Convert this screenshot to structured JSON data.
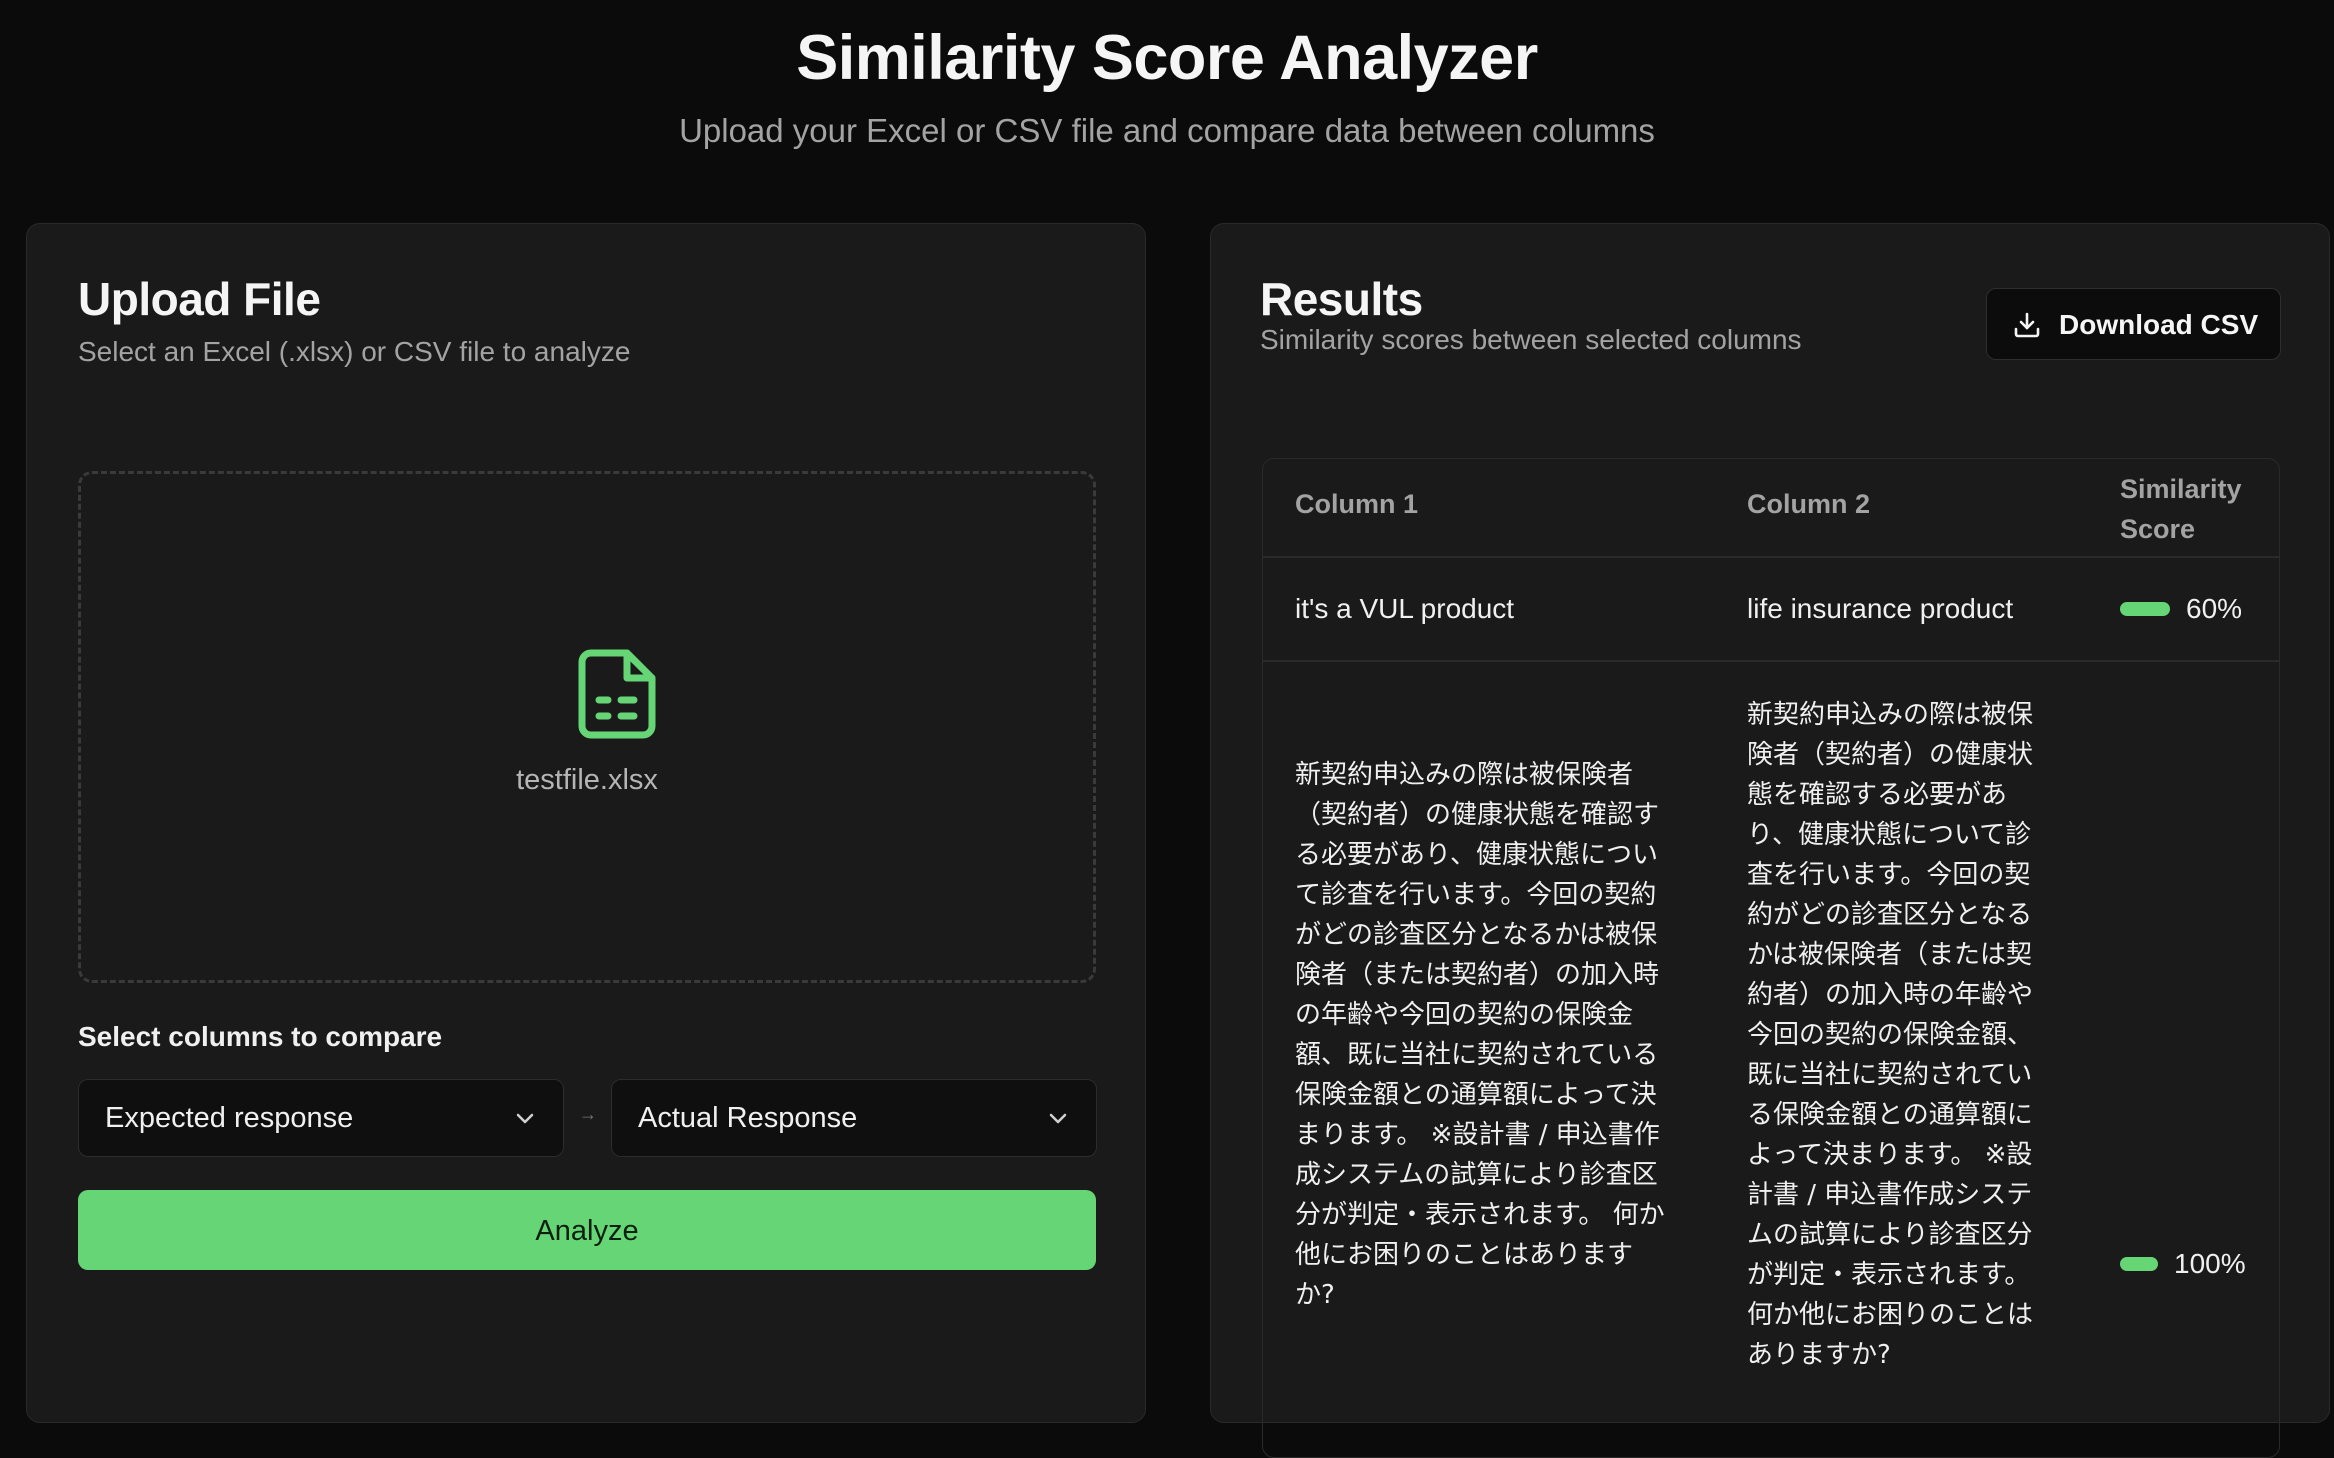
{
  "header": {
    "title": "Similarity Score Analyzer",
    "subtitle": "Upload your Excel or CSV file and compare data between columns"
  },
  "upload": {
    "title": "Upload File",
    "description": "Select an Excel (.xlsx) or CSV file to analyze",
    "file_name": "testfile.xlsx",
    "file_icon": "file-spreadsheet-icon",
    "columns_label": "Select columns to compare",
    "column1_selected": "Expected response",
    "column2_selected": "Actual Response",
    "arrow": "→",
    "analyze_label": "Analyze"
  },
  "results": {
    "title": "Results",
    "description": "Similarity scores between selected columns",
    "download_label": "Download CSV",
    "download_icon": "download-icon",
    "table": {
      "headers": [
        "Column 1",
        "Column 2",
        "Similarity Score"
      ],
      "header_score_line1": "Similarity",
      "header_score_line2": "Score",
      "rows": [
        {
          "col1": "it's a VUL product",
          "col2": "life insurance product",
          "score": 0.6,
          "score_label": "60%"
        },
        {
          "col1_lines": [
            "新契約申込みの際は被保険者",
            "（契約者）の健康状態を確認す",
            "る必要があり、健康状態につい",
            "て診査を行います。今回の契約",
            "がどの診査区分となるかは被保",
            "険者（または契約者）の加入時",
            "の年齢や今回の契約の保険金",
            "額、既に当社に契約されている",
            "保険金額との通算額によって決",
            "まります。 ※設計書 / 申込書作",
            "成システムの試算により診査区",
            "分が判定・表示されます。 何か",
            "他にお困りのことはあります",
            "か?"
          ],
          "col2_lines": [
            "新契約申込みの際は被保",
            "険者（契約者）の健康状",
            "態を確認する必要があ",
            "り、健康状態について診",
            "査を行います。今回の契",
            "約がどの診査区分となる",
            "かは被保険者（または契",
            "約者）の加入時の年齢や",
            "今回の契約の保険金額、",
            "既に当社に契約されてい",
            "る保険金額との通算額に",
            "よって決まります。 ※設",
            "計書 / 申込書作成システ",
            "ムの試算により診査区分",
            "が判定・表示されます。",
            "何か他にお困りのことは",
            "ありますか?"
          ],
          "score": 1.0,
          "score_label": "100%"
        }
      ]
    }
  },
  "colors": {
    "accent": "#66d575",
    "background": "#0b0b0b",
    "card": "#1a1a1a"
  }
}
